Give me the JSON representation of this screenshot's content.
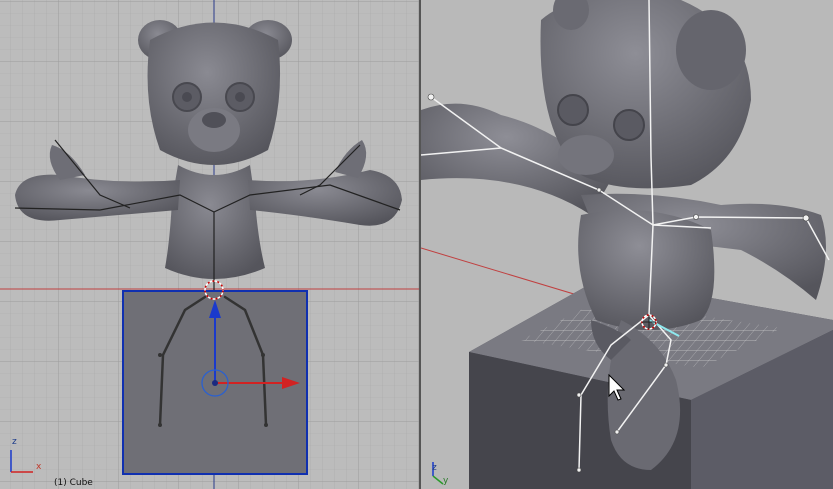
{
  "front_viewport": {
    "object_label": "(1) Cube",
    "axis_x": "x",
    "axis_z": "z"
  },
  "persp_viewport": {
    "axis_y": "y",
    "axis_z": "z"
  },
  "colors": {
    "grid_bg": "#bcbcbc",
    "cube_face": "#6f6f76",
    "cube_outline": "#1030b0",
    "mesh": "#6a6a72",
    "bone": "#2a2a2a",
    "axis_red": "#d22222",
    "axis_blue": "#1a3acc"
  }
}
